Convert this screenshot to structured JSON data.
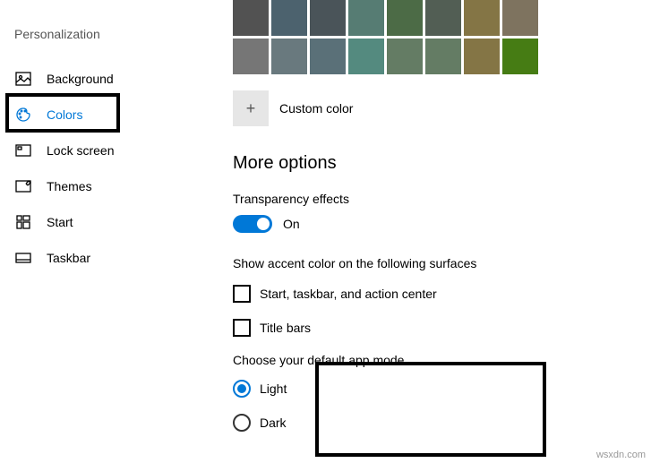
{
  "sidebar": {
    "title": "Personalization",
    "items": [
      {
        "label": "Background"
      },
      {
        "label": "Colors"
      },
      {
        "label": "Lock screen"
      },
      {
        "label": "Themes"
      },
      {
        "label": "Start"
      },
      {
        "label": "Taskbar"
      }
    ]
  },
  "color_swatches": {
    "row1": [
      "#525252",
      "#4c626e",
      "#4a5459",
      "#567c73",
      "#4c6b46",
      "#525e54",
      "#847545",
      "#7e735f"
    ],
    "row2": [
      "#767676",
      "#69797e",
      "#5a7078",
      "#548a7f",
      "#647c64",
      "#647c64",
      "#847545",
      "#467c14"
    ]
  },
  "custom_color": {
    "label": "Custom color",
    "plus": "+"
  },
  "more_options": {
    "heading": "More options",
    "transparency": {
      "label": "Transparency effects",
      "state": "On"
    },
    "accent_surfaces": {
      "label": "Show accent color on the following surfaces",
      "checks": [
        {
          "label": "Start, taskbar, and action center"
        },
        {
          "label": "Title bars"
        }
      ]
    },
    "app_mode": {
      "label": "Choose your default app mode",
      "options": [
        {
          "label": "Light"
        },
        {
          "label": "Dark"
        }
      ]
    }
  },
  "watermark": "wsxdn.com"
}
